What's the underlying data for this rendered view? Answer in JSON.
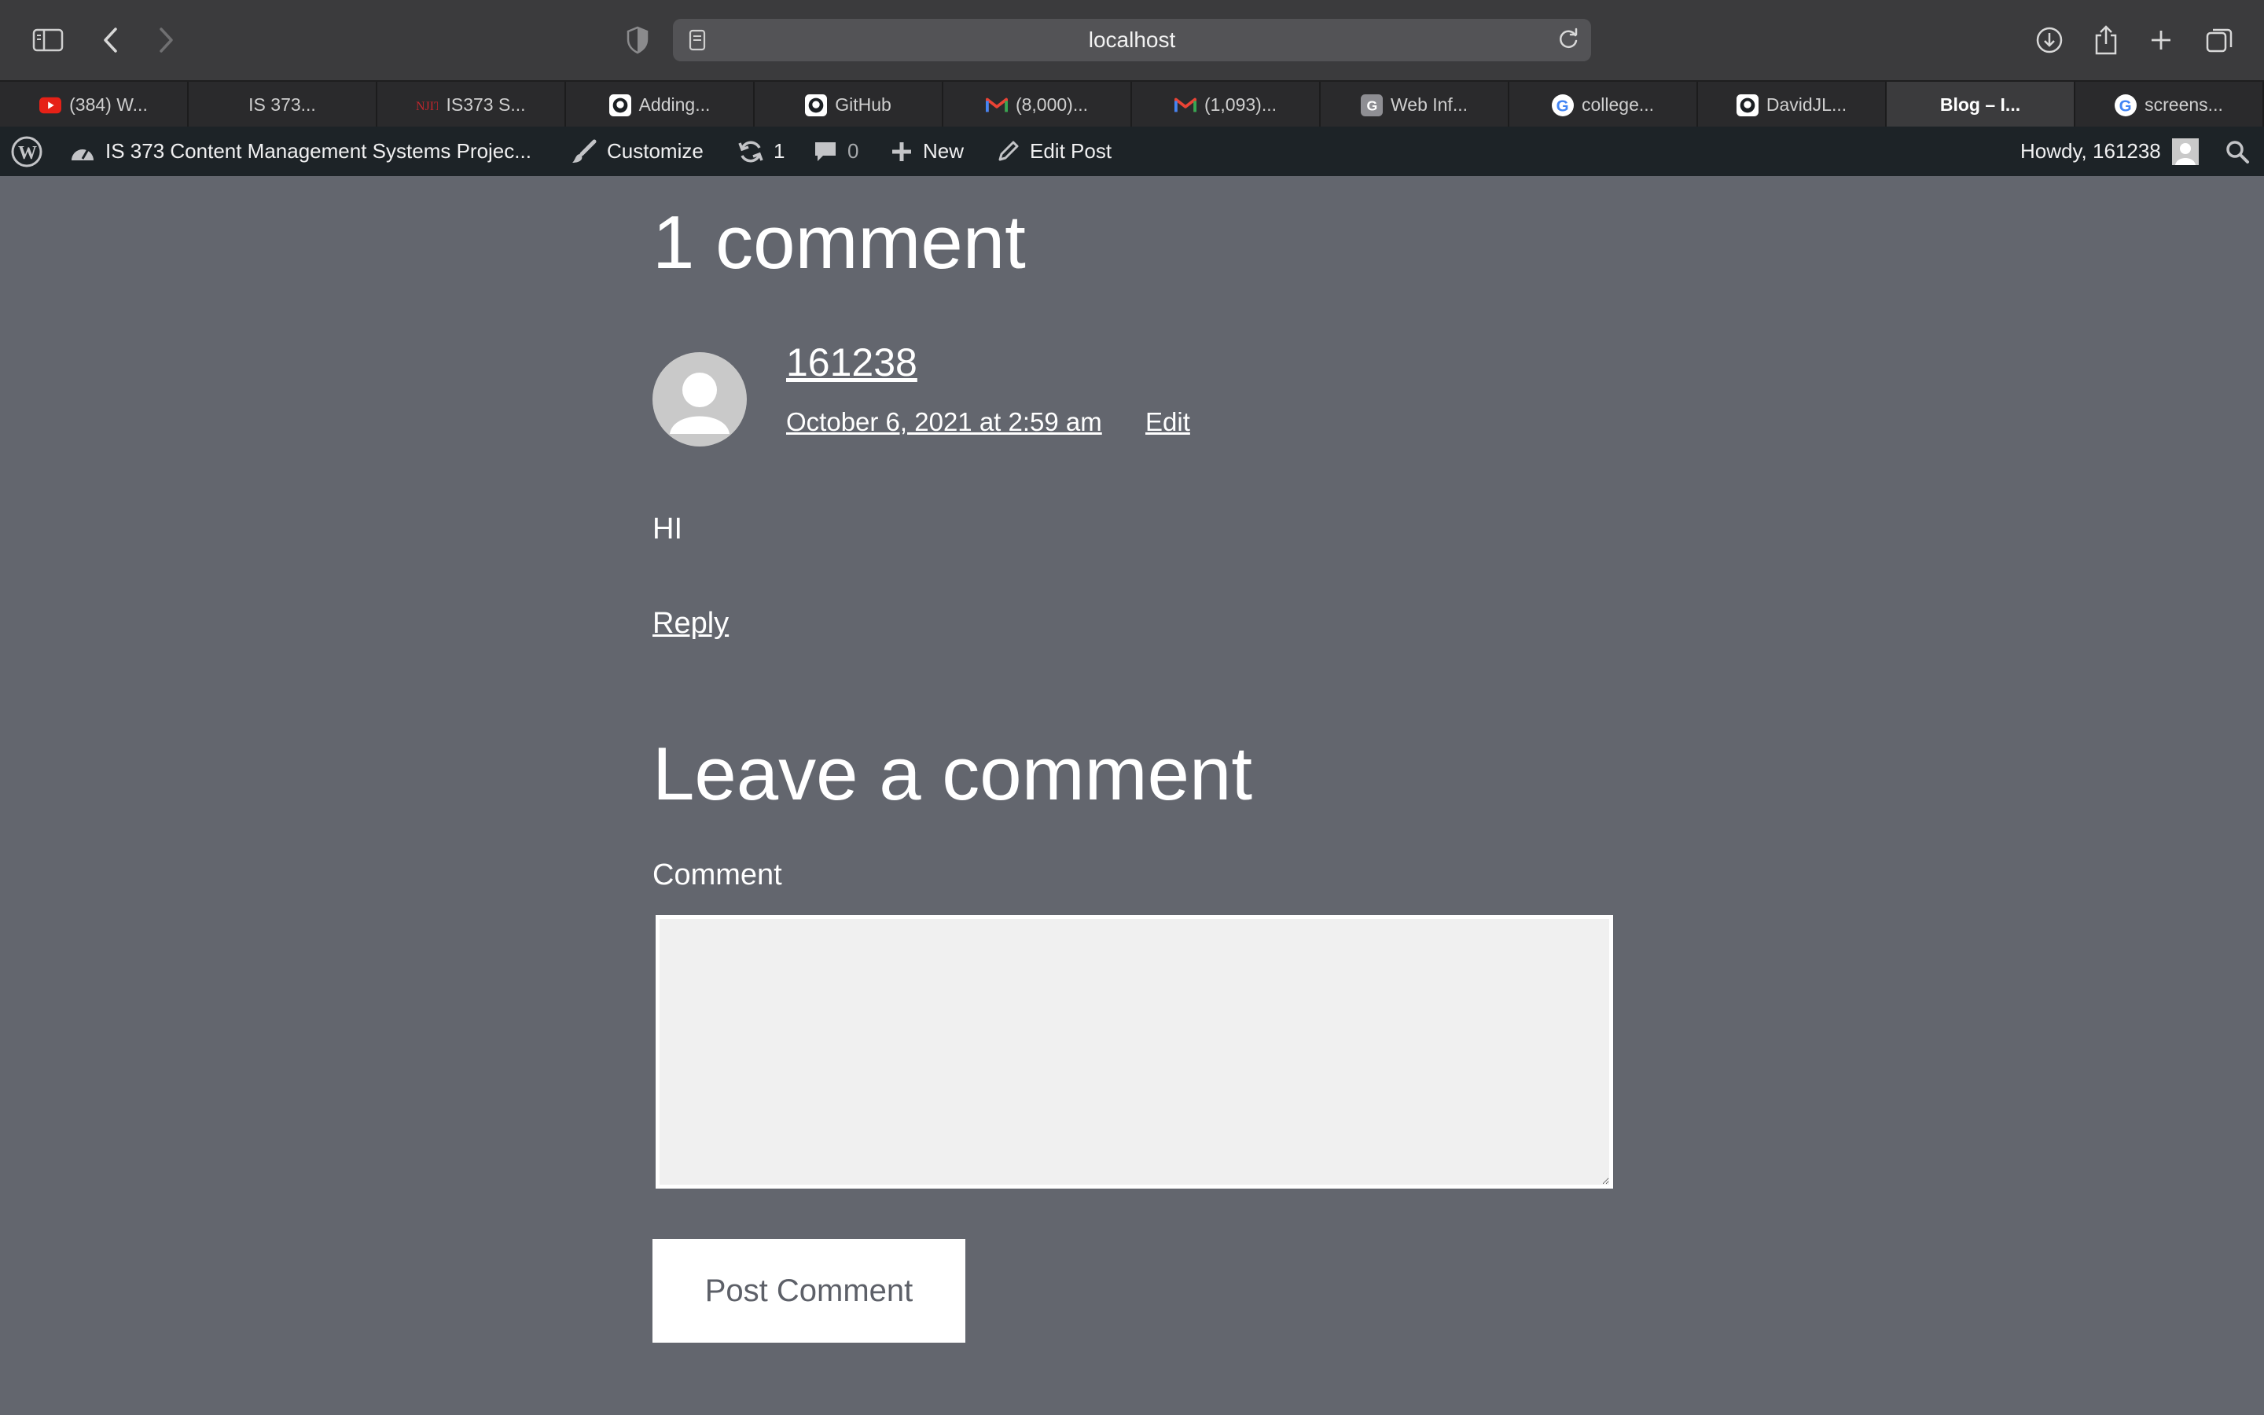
{
  "browser": {
    "url": "localhost",
    "tabs": [
      {
        "label": "(384) W...",
        "icon": "youtube-icon",
        "color": "#e62117",
        "active": false
      },
      {
        "label": "IS 373...",
        "icon": "none",
        "active": false
      },
      {
        "label": "IS373 S...",
        "icon": "njit-icon",
        "color": "#c0262d",
        "active": false
      },
      {
        "label": "Adding...",
        "icon": "github-icon",
        "active": false
      },
      {
        "label": "GitHub",
        "icon": "github-icon",
        "active": false
      },
      {
        "label": "(8,000)...",
        "icon": "gmail-icon",
        "active": false
      },
      {
        "label": "(1,093)...",
        "icon": "gmail-icon",
        "active": false
      },
      {
        "label": "Web Inf...",
        "icon": "g-letter-icon",
        "active": false
      },
      {
        "label": "college...",
        "icon": "google-icon",
        "active": false
      },
      {
        "label": "DavidJL...",
        "icon": "github-icon",
        "active": false
      },
      {
        "label": "Blog – I...",
        "icon": "none",
        "active": true
      },
      {
        "label": "screens...",
        "icon": "google-icon",
        "active": false
      }
    ]
  },
  "adminbar": {
    "site_name": "IS 373 Content Management Systems Projec...",
    "customize": "Customize",
    "updates_count": "1",
    "comments_count": "0",
    "new": "New",
    "edit_post": "Edit Post",
    "howdy": "Howdy, 161238"
  },
  "comments": {
    "title": "1 comment",
    "items": [
      {
        "author": "161238",
        "date": "October 6, 2021 at 2:59 am",
        "edit": "Edit",
        "text": "HI",
        "reply": "Reply"
      }
    ]
  },
  "form": {
    "title": "Leave a comment",
    "comment_label": "Comment",
    "comment_value": "",
    "submit": "Post Comment"
  },
  "colors": {
    "page_bg": "#63666e",
    "adminbar_bg": "#1d2327",
    "toolbar_bg": "#3b3b3d",
    "tabbar_bg": "#2a2a2c"
  }
}
